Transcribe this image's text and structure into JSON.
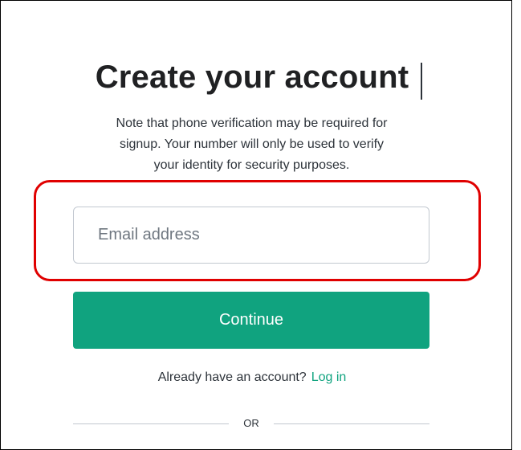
{
  "page": {
    "title": "Create your account",
    "note_line1": "Note that phone verification may be required for",
    "note_line2": "signup. Your number will only be used to verify",
    "note_line3": "your identity for security purposes."
  },
  "form": {
    "email_placeholder": "Email address",
    "email_value": "",
    "continue_label": "Continue"
  },
  "login": {
    "prompt": "Already have an account?",
    "link_label": "Log in"
  },
  "divider": {
    "label": "OR"
  },
  "colors": {
    "accent": "#10a37f",
    "highlight": "#e00000",
    "text": "#2d333a"
  }
}
